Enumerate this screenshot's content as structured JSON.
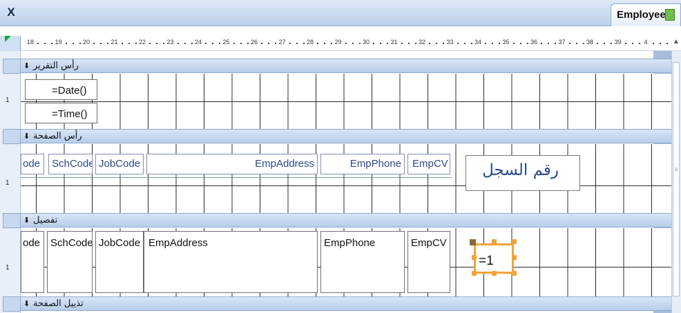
{
  "window": {
    "close_label": "X",
    "tab_title": "Employee"
  },
  "ruler": {
    "labels": [
      "18",
      "19",
      "20",
      "21",
      "22",
      "23",
      "24",
      "25",
      "26",
      "27",
      "28",
      "29",
      "30",
      "31",
      "32",
      "33",
      "34",
      "35",
      "36",
      "37",
      "38",
      "39",
      "4"
    ]
  },
  "vruler": {
    "mark1": "1"
  },
  "sections": {
    "report_header": "رأس التقرير",
    "page_header": "رأس الصفحة",
    "detail": "تفصيل",
    "page_footer": "تذييل الصفحة"
  },
  "report_header": {
    "date_expr": "=Date()",
    "time_expr": "=Time()"
  },
  "page_header": {
    "labels": [
      "ode",
      "SchCode",
      "JobCode",
      "EmpAddress",
      "EmpPhone",
      "EmpCV"
    ],
    "record_number_label": "رقم السجل"
  },
  "detail": {
    "fields": [
      "ode",
      "SchCode",
      "JobCode",
      "EmpAddress",
      "EmpPhone",
      "EmpCV"
    ],
    "counter_expr": "=1"
  },
  "colors": {
    "title_bar": "#c9daf1",
    "section_bar": "#c6d8f0",
    "selection": "#f3a33a",
    "tab_icon": "#6cbf4a"
  },
  "icons": {
    "close": "close-icon",
    "tab": "table-icon",
    "section": "section-arrow-icon"
  }
}
